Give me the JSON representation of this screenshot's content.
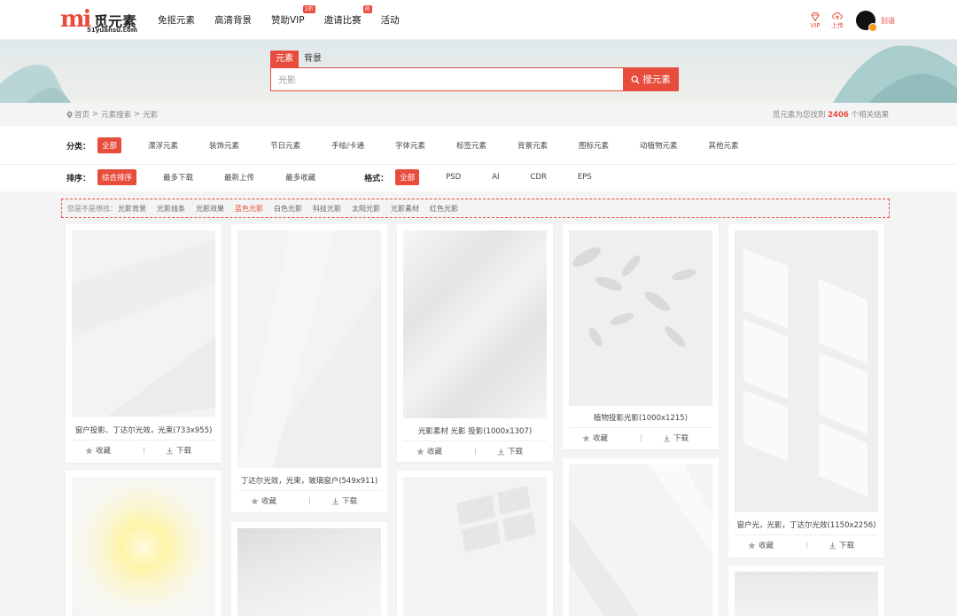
{
  "header": {
    "logo_mark": "mi",
    "logo_text": "觅元素",
    "logo_sub": "51yuansu.com",
    "nav": [
      {
        "label": "免抠元素",
        "badge": ""
      },
      {
        "label": "高清背景",
        "badge": ""
      },
      {
        "label": "赞助VIP",
        "badge": "2折"
      },
      {
        "label": "邀请比赛",
        "badge": "热"
      },
      {
        "label": "活动",
        "badge": ""
      }
    ],
    "vip_label": "VIP",
    "upload_label": "上传",
    "user_name": "别语"
  },
  "search": {
    "tabs": [
      "元素",
      "背景"
    ],
    "active_tab": 0,
    "query": "光影",
    "button_label": "搜元素"
  },
  "breadcrumb": {
    "items": [
      "首页",
      ">",
      "元素搜索",
      ">",
      "光影"
    ],
    "result_prefix": "觅元素为您找到",
    "result_count": "2406",
    "result_suffix": "个相关结果"
  },
  "filters": {
    "category_label": "分类：",
    "categories": [
      "全部",
      "漂浮元素",
      "装饰元素",
      "节日元素",
      "手绘/卡通",
      "字体元素",
      "标签元素",
      "背景元素",
      "图标元素",
      "动植物元素",
      "其他元素"
    ],
    "category_selected": 0,
    "sort_label": "排序：",
    "sorts": [
      "综合排序",
      "最多下载",
      "最新上传",
      "最多收藏"
    ],
    "sort_selected": 0,
    "format_label": "格式：",
    "formats": [
      "全部",
      "PSD",
      "AI",
      "CDR",
      "EPS"
    ],
    "format_selected": 0
  },
  "suggest": {
    "label": "您是不是想找：",
    "items": [
      "光影背景",
      "光影线条",
      "光影效果",
      "蓝色光影",
      "白色光影",
      "科技光影",
      "太阳光影",
      "光影素材",
      "红色光影"
    ],
    "highlight": 3
  },
  "cards": [
    {
      "title": "窗户投影、丁达尔光效，光束(733x955)",
      "fav": "收藏",
      "dl": "下载"
    },
    {
      "title": "丁达尔光效，光束，玻璃窗户(549x911)",
      "fav": "收藏",
      "dl": "下载"
    },
    {
      "title": "光影素材 光影 投影(1000x1307)",
      "fav": "收藏",
      "dl": "下载"
    },
    {
      "title": "植物投影光影(1000x1215)",
      "fav": "收藏",
      "dl": "下载"
    },
    {
      "title": "窗户光，光影，丁达尔光效(1150x2256)",
      "fav": "收藏",
      "dl": "下载"
    },
    {
      "title": "",
      "fav": "",
      "dl": ""
    },
    {
      "title": "",
      "fav": "",
      "dl": ""
    },
    {
      "title": "",
      "fav": "",
      "dl": ""
    },
    {
      "title": "",
      "fav": "",
      "dl": ""
    },
    {
      "title": "",
      "fav": "",
      "dl": ""
    }
  ],
  "colors": {
    "accent": "#e84c3d"
  }
}
